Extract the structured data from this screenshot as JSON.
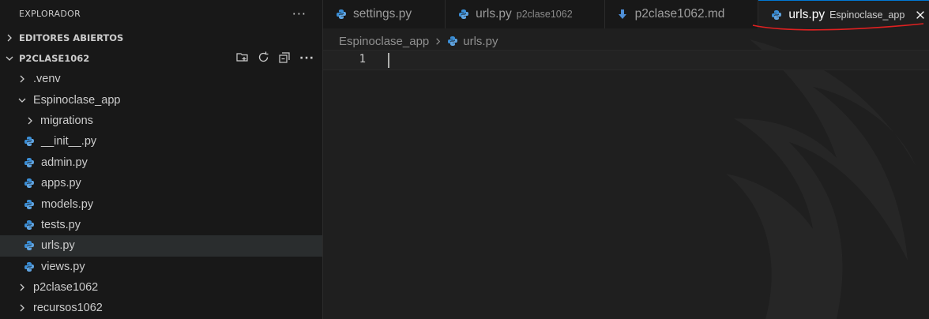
{
  "sidebar": {
    "title": "EXPLORADOR",
    "more_label": "···",
    "sections": [
      {
        "label": "EDITORES ABIERTOS"
      },
      {
        "label": "P2CLASE1062"
      }
    ],
    "tree": [
      {
        "label": ".venv"
      },
      {
        "label": "Espinoclase_app"
      },
      {
        "label": "migrations"
      },
      {
        "label": "__init__.py"
      },
      {
        "label": "admin.py"
      },
      {
        "label": "apps.py"
      },
      {
        "label": "models.py"
      },
      {
        "label": "tests.py"
      },
      {
        "label": "urls.py"
      },
      {
        "label": "views.py"
      },
      {
        "label": "p2clase1062"
      },
      {
        "label": "recursos1062"
      }
    ]
  },
  "tabs": [
    {
      "label": "settings.py",
      "description": ""
    },
    {
      "label": "urls.py",
      "description": "p2clase1062"
    },
    {
      "label": "p2clase1062.md",
      "description": ""
    },
    {
      "label": "urls.py",
      "description": "Espinoclase_app"
    }
  ],
  "breadcrumb": {
    "folder": "Espinoclase_app",
    "file": "urls.py"
  },
  "editor": {
    "line_number": "1"
  },
  "colors": {
    "accent": "#0078d4",
    "python_blue": "#3b8ed6",
    "annotation_red": "#e02020"
  }
}
